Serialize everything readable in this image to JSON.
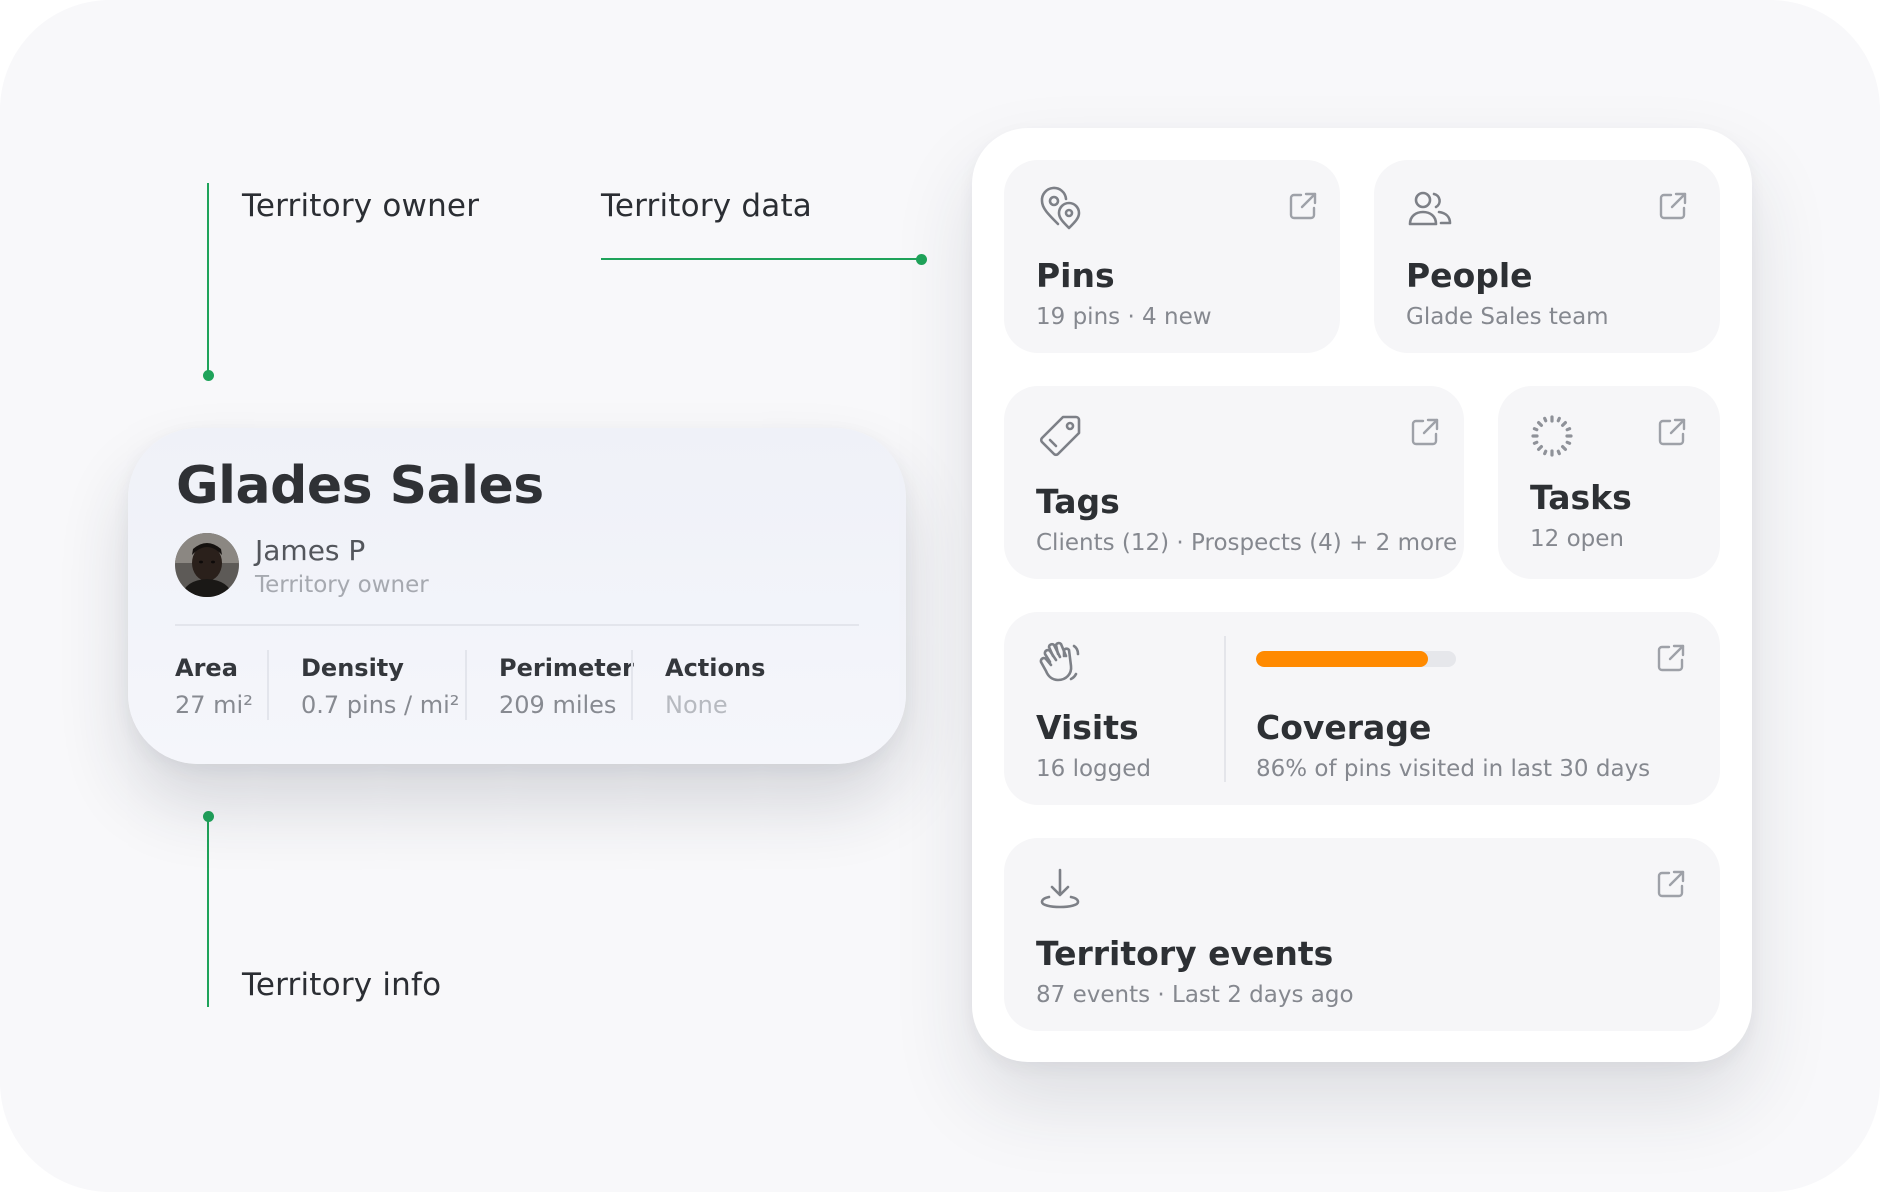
{
  "annotations": {
    "owner": "Territory owner",
    "data": "Territory data",
    "info": "Territory info"
  },
  "info_card": {
    "title": "Glades Sales",
    "owner_name": "James P",
    "owner_role": "Territory owner",
    "stats": [
      {
        "label": "Area",
        "value": "27 mi²"
      },
      {
        "label": "Density",
        "value": "0.7 pins / mi²"
      },
      {
        "label": "Perimeter",
        "value": "209 miles"
      },
      {
        "label": "Actions",
        "value": "None"
      }
    ]
  },
  "tiles": {
    "pins": {
      "title": "Pins",
      "sub": "19 pins · 4 new",
      "icon": "map-pin-pair-icon"
    },
    "people": {
      "title": "People",
      "sub": "Glade Sales team",
      "icon": "people-icon"
    },
    "tags": {
      "title": "Tags",
      "sub": "Clients (12) · Prospects (4) + 2 more",
      "icon": "tag-icon"
    },
    "tasks": {
      "title": "Tasks",
      "sub": "12 open",
      "icon": "loader-icon"
    },
    "visits": {
      "title": "Visits",
      "sub": "16 logged",
      "icon": "waving-hand-icon"
    },
    "coverage": {
      "title": "Coverage",
      "sub": "86% of pins visited in last 30 days",
      "progress": 0.86
    },
    "events": {
      "title": "Territory events",
      "sub": "87 events · Last 2 days ago",
      "icon": "download-icon"
    }
  },
  "colors": {
    "accent_green": "#1fa35a",
    "progress_orange": "#ff8a00"
  }
}
